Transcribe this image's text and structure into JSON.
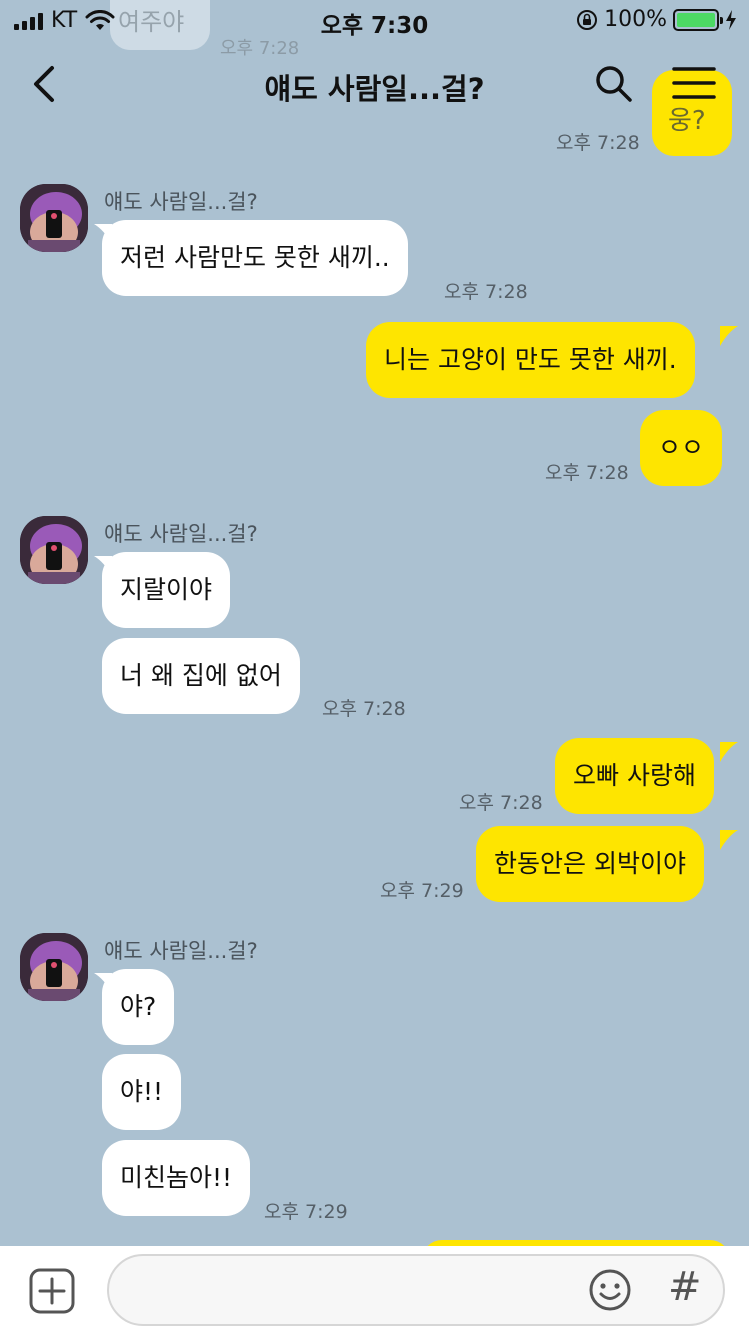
{
  "status_bar": {
    "carrier": "KT",
    "time": "오후 7:30",
    "battery_percent": "100%",
    "battery_level": 1.0,
    "battery_color": "#4cd964"
  },
  "header": {
    "title": "얘도 사람일...걸?",
    "back_icon": "chevron-left-icon",
    "search_icon": "search-icon",
    "menu_icon": "hamburger-menu-icon"
  },
  "residual": {
    "top_text": "여주야",
    "top_time": "오후 7:28",
    "right_text": "웅?"
  },
  "messages": {
    "time_0": "오후 7:28",
    "group1": {
      "sender": "얘도 사람일...걸?",
      "bubble_0": "저런 사람만도 못한 새끼..",
      "time": "오후 7:28"
    },
    "out1": {
      "bubble_0": "니는 고양이 만도 못한 새끼.",
      "bubble_1": "ㅇㅇ",
      "time": "오후 7:28"
    },
    "group2": {
      "sender": "얘도 사람일...걸?",
      "bubble_0": "지랄이야",
      "bubble_1": "너 왜 집에 없어",
      "time": "오후 7:28"
    },
    "out2": {
      "bubble_0": "오빠 사랑해",
      "time_0": "오후 7:28",
      "bubble_1": "한동안은 외박이야",
      "time_1": "오후 7:29"
    },
    "group3": {
      "sender": "얘도 사람일...걸?",
      "bubble_0": "야?",
      "bubble_1": "야!!",
      "bubble_2": "미친놈아!!",
      "time": "오후 7:29"
    }
  },
  "composer": {
    "placeholder": "",
    "add_icon": "plus-icon",
    "emoji_icon": "emoji-icon",
    "hashtag_label": "#"
  },
  "colors": {
    "background": "#abc1d1",
    "my_bubble": "#fee500",
    "their_bubble": "#ffffff"
  }
}
